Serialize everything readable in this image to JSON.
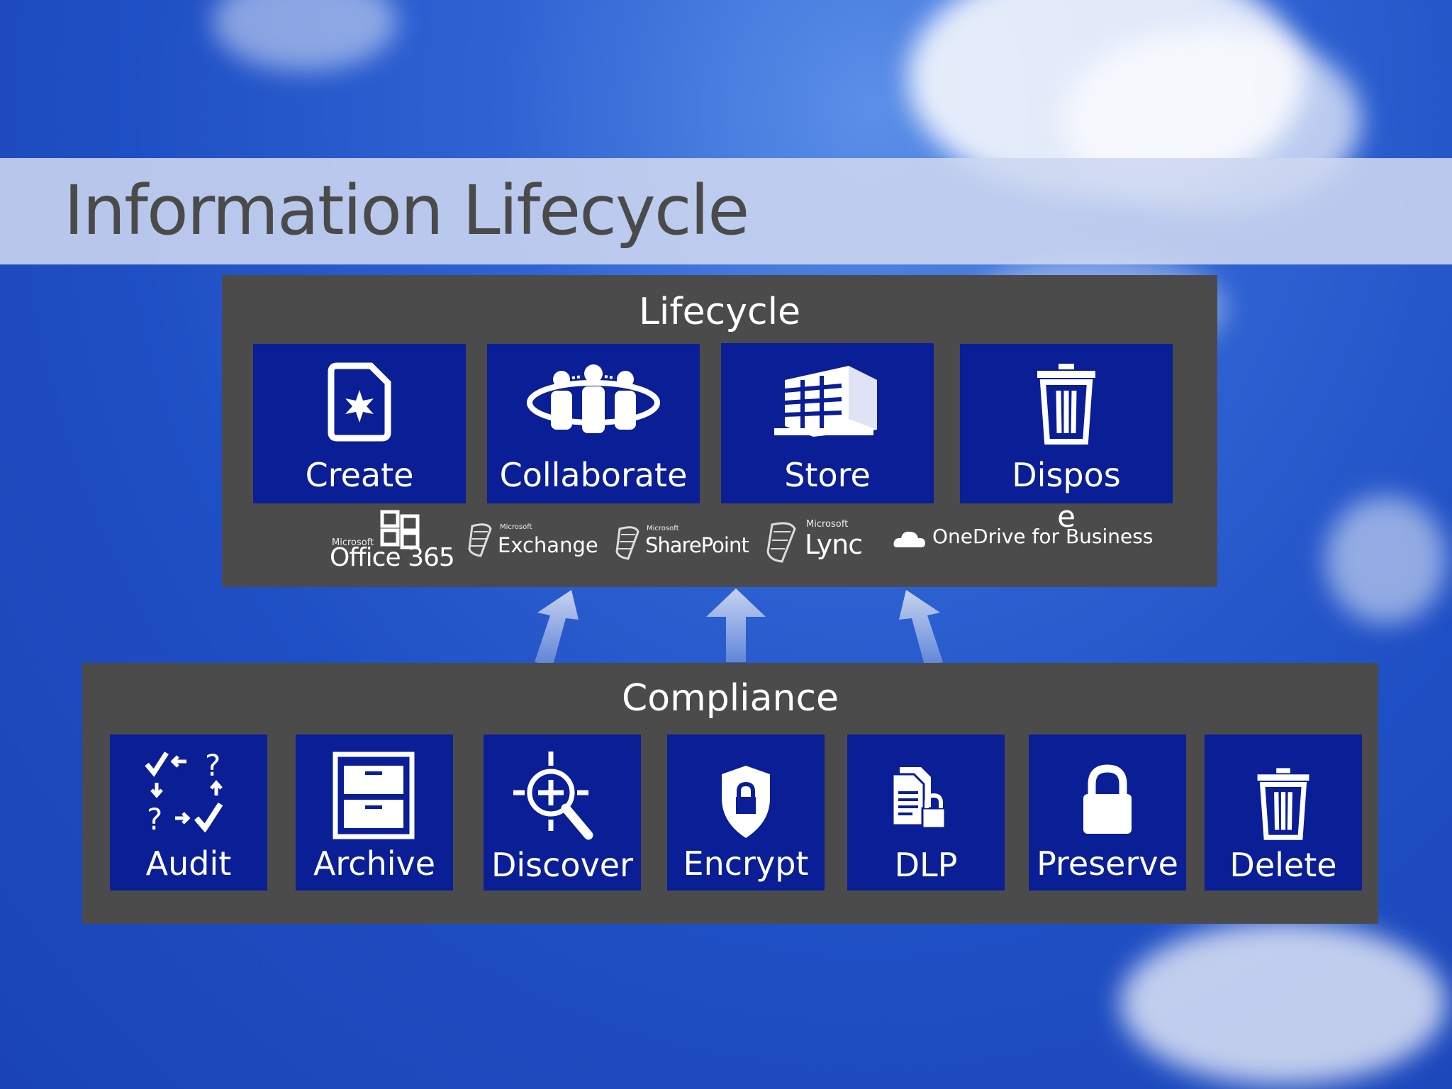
{
  "slide": {
    "title": "Information Lifecycle"
  },
  "lifecycle": {
    "heading": "Lifecycle",
    "tiles": [
      {
        "label": "Create",
        "icon": "new-document-icon"
      },
      {
        "label": "Collaborate",
        "icon": "team-icon"
      },
      {
        "label": "Store",
        "icon": "building-icon"
      },
      {
        "label": "Dispos",
        "label_wrap": "e",
        "icon": "trash-icon"
      }
    ],
    "products": [
      {
        "brand": "Microsoft",
        "name": "Office 365",
        "icon": "office365-icon"
      },
      {
        "brand": "Microsoft",
        "name": "Exchange",
        "icon": "exchange-icon"
      },
      {
        "brand": "Microsoft",
        "name": "SharePoint",
        "icon": "sharepoint-icon"
      },
      {
        "brand": "Microsoft",
        "name": "Lync",
        "icon": "lync-icon"
      },
      {
        "brand": "",
        "name": "OneDrive for Business",
        "icon": "cloud-icon"
      }
    ]
  },
  "compliance": {
    "heading": "Compliance",
    "tiles": [
      {
        "label": "Audit",
        "icon": "checklist-icon"
      },
      {
        "label": "Archive",
        "icon": "filing-cabinet-icon"
      },
      {
        "label": "Discover",
        "icon": "magnifier-icon"
      },
      {
        "label": "Encrypt",
        "icon": "shield-lock-icon"
      },
      {
        "label": "DLP",
        "icon": "document-lock-icon"
      },
      {
        "label": "Preserve",
        "icon": "padlock-icon"
      },
      {
        "label": "Delete",
        "icon": "trash-icon"
      }
    ]
  },
  "colors": {
    "tile": "#0a1e95",
    "panel": "#4b4b4b",
    "title_band": "#cdd7f0",
    "sky": "#2f63d3"
  }
}
